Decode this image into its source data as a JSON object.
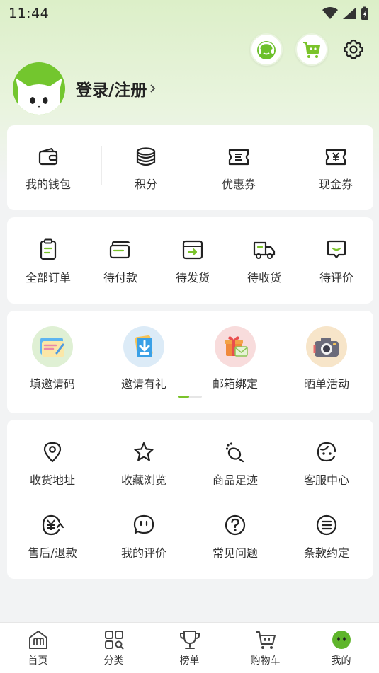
{
  "status_bar": {
    "time": "11:44"
  },
  "profile": {
    "login_label": "登录/注册"
  },
  "wallet": [
    {
      "label": "我的钱包",
      "icon": "wallet-icon"
    },
    {
      "label": "积分",
      "icon": "coins-icon"
    },
    {
      "label": "优惠券",
      "icon": "coupon-icon"
    },
    {
      "label": "现金券",
      "icon": "cash-coupon-icon"
    }
  ],
  "orders": [
    {
      "label": "全部订单",
      "icon": "clipboard-icon"
    },
    {
      "label": "待付款",
      "icon": "card-icon"
    },
    {
      "label": "待发货",
      "icon": "ship-box-icon"
    },
    {
      "label": "待收货",
      "icon": "truck-icon"
    },
    {
      "label": "待评价",
      "icon": "chat-smile-icon"
    }
  ],
  "promotions": [
    {
      "label": "填邀请码",
      "icon": "invite-code-icon"
    },
    {
      "label": "邀请有礼",
      "icon": "invite-gift-icon"
    },
    {
      "label": "邮箱绑定",
      "icon": "email-gift-icon"
    },
    {
      "label": "晒单活动",
      "icon": "camera-icon"
    }
  ],
  "services": [
    {
      "label": "收货地址",
      "icon": "location-icon"
    },
    {
      "label": "收藏浏览",
      "icon": "star-icon"
    },
    {
      "label": "商品足迹",
      "icon": "footprint-icon"
    },
    {
      "label": "客服中心",
      "icon": "headset-face-icon"
    },
    {
      "label": "售后/退款",
      "icon": "refund-icon"
    },
    {
      "label": "我的评价",
      "icon": "comment-icon"
    },
    {
      "label": "常见问题",
      "icon": "question-icon"
    },
    {
      "label": "条款约定",
      "icon": "terms-icon"
    }
  ],
  "tabbar": [
    {
      "label": "首页",
      "icon": "home-icon"
    },
    {
      "label": "分类",
      "icon": "category-icon"
    },
    {
      "label": "榜单",
      "icon": "trophy-icon"
    },
    {
      "label": "购物车",
      "icon": "cart-icon"
    },
    {
      "label": "我的",
      "icon": "mine-icon",
      "active": true
    }
  ],
  "colors": {
    "accent": "#7ac32a",
    "text": "#333333",
    "background": "#f2f3f4"
  }
}
